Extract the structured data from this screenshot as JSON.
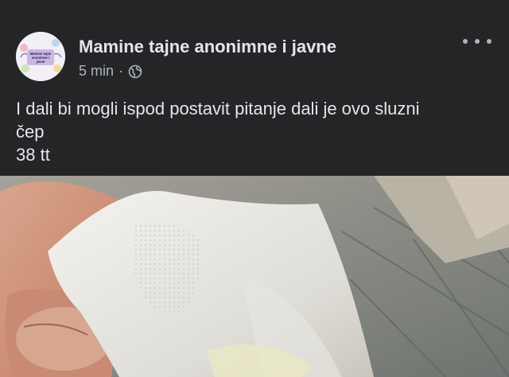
{
  "post": {
    "group_name": "Mamine tajne anonimne i javne",
    "time": "5 min",
    "separator": "·",
    "privacy_icon": "globe-icon",
    "more_icon": "more-options-icon",
    "text_lines": [
      "I dali bi mogli ispod postavit pitanje dali je ovo sluzni",
      "čep",
      "38 tt"
    ],
    "avatar": {
      "line1": "Mamine tajne",
      "line2": "anonimne i",
      "line3": "javne"
    }
  },
  "colors": {
    "background": "#242526",
    "primary_text": "#e4e6eb",
    "secondary_text": "#b0b3b8"
  }
}
